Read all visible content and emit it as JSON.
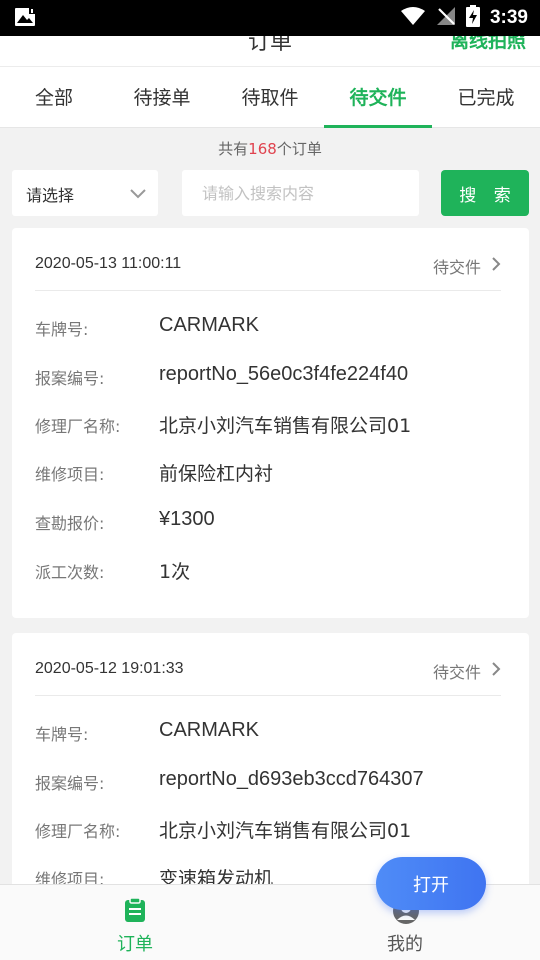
{
  "status_bar": {
    "time": "3:39"
  },
  "header": {
    "title": "订单",
    "action": "离线拍照"
  },
  "tabs": [
    {
      "label": "全部"
    },
    {
      "label": "待接单"
    },
    {
      "label": "待取件"
    },
    {
      "label": "待交件"
    },
    {
      "label": "已完成"
    }
  ],
  "summary": {
    "prefix": "共有",
    "count": "168",
    "suffix": "个订单"
  },
  "filter": {
    "label": "请选择"
  },
  "search": {
    "placeholder": "请输入搜索内容",
    "button": "搜 索"
  },
  "orders": [
    {
      "time": "2020-05-13 11:00:11",
      "status": "待交件",
      "fields": [
        {
          "label": "车牌号:",
          "value": "CARMARK"
        },
        {
          "label": "报案编号:",
          "value": "reportNo_56e0c3f4fe224f40"
        },
        {
          "label": "修理厂名称:",
          "value": "北京小刘汽车销售有限公司01"
        },
        {
          "label": "维修项目:",
          "value": "前保险杠内衬"
        },
        {
          "label": "查勘报价:",
          "value": "¥1300"
        },
        {
          "label": "派工次数:",
          "value": "1次"
        }
      ]
    },
    {
      "time": "2020-05-12 19:01:33",
      "status": "待交件",
      "fields": [
        {
          "label": "车牌号:",
          "value": "CARMARK"
        },
        {
          "label": "报案编号:",
          "value": "reportNo_d693eb3ccd764307"
        },
        {
          "label": "修理厂名称:",
          "value": "北京小刘汽车销售有限公司01"
        },
        {
          "label": "维修项目:",
          "value": "变速箱发动机"
        }
      ]
    }
  ],
  "bottom_nav": [
    {
      "label": "订单",
      "icon": "order-icon"
    },
    {
      "label": "我的",
      "icon": "profile-icon"
    }
  ],
  "floating": {
    "open_label": "打开"
  },
  "colors": {
    "accent": "#1fb35a",
    "count": "#e0434f",
    "open_button": "#4a84f5"
  }
}
